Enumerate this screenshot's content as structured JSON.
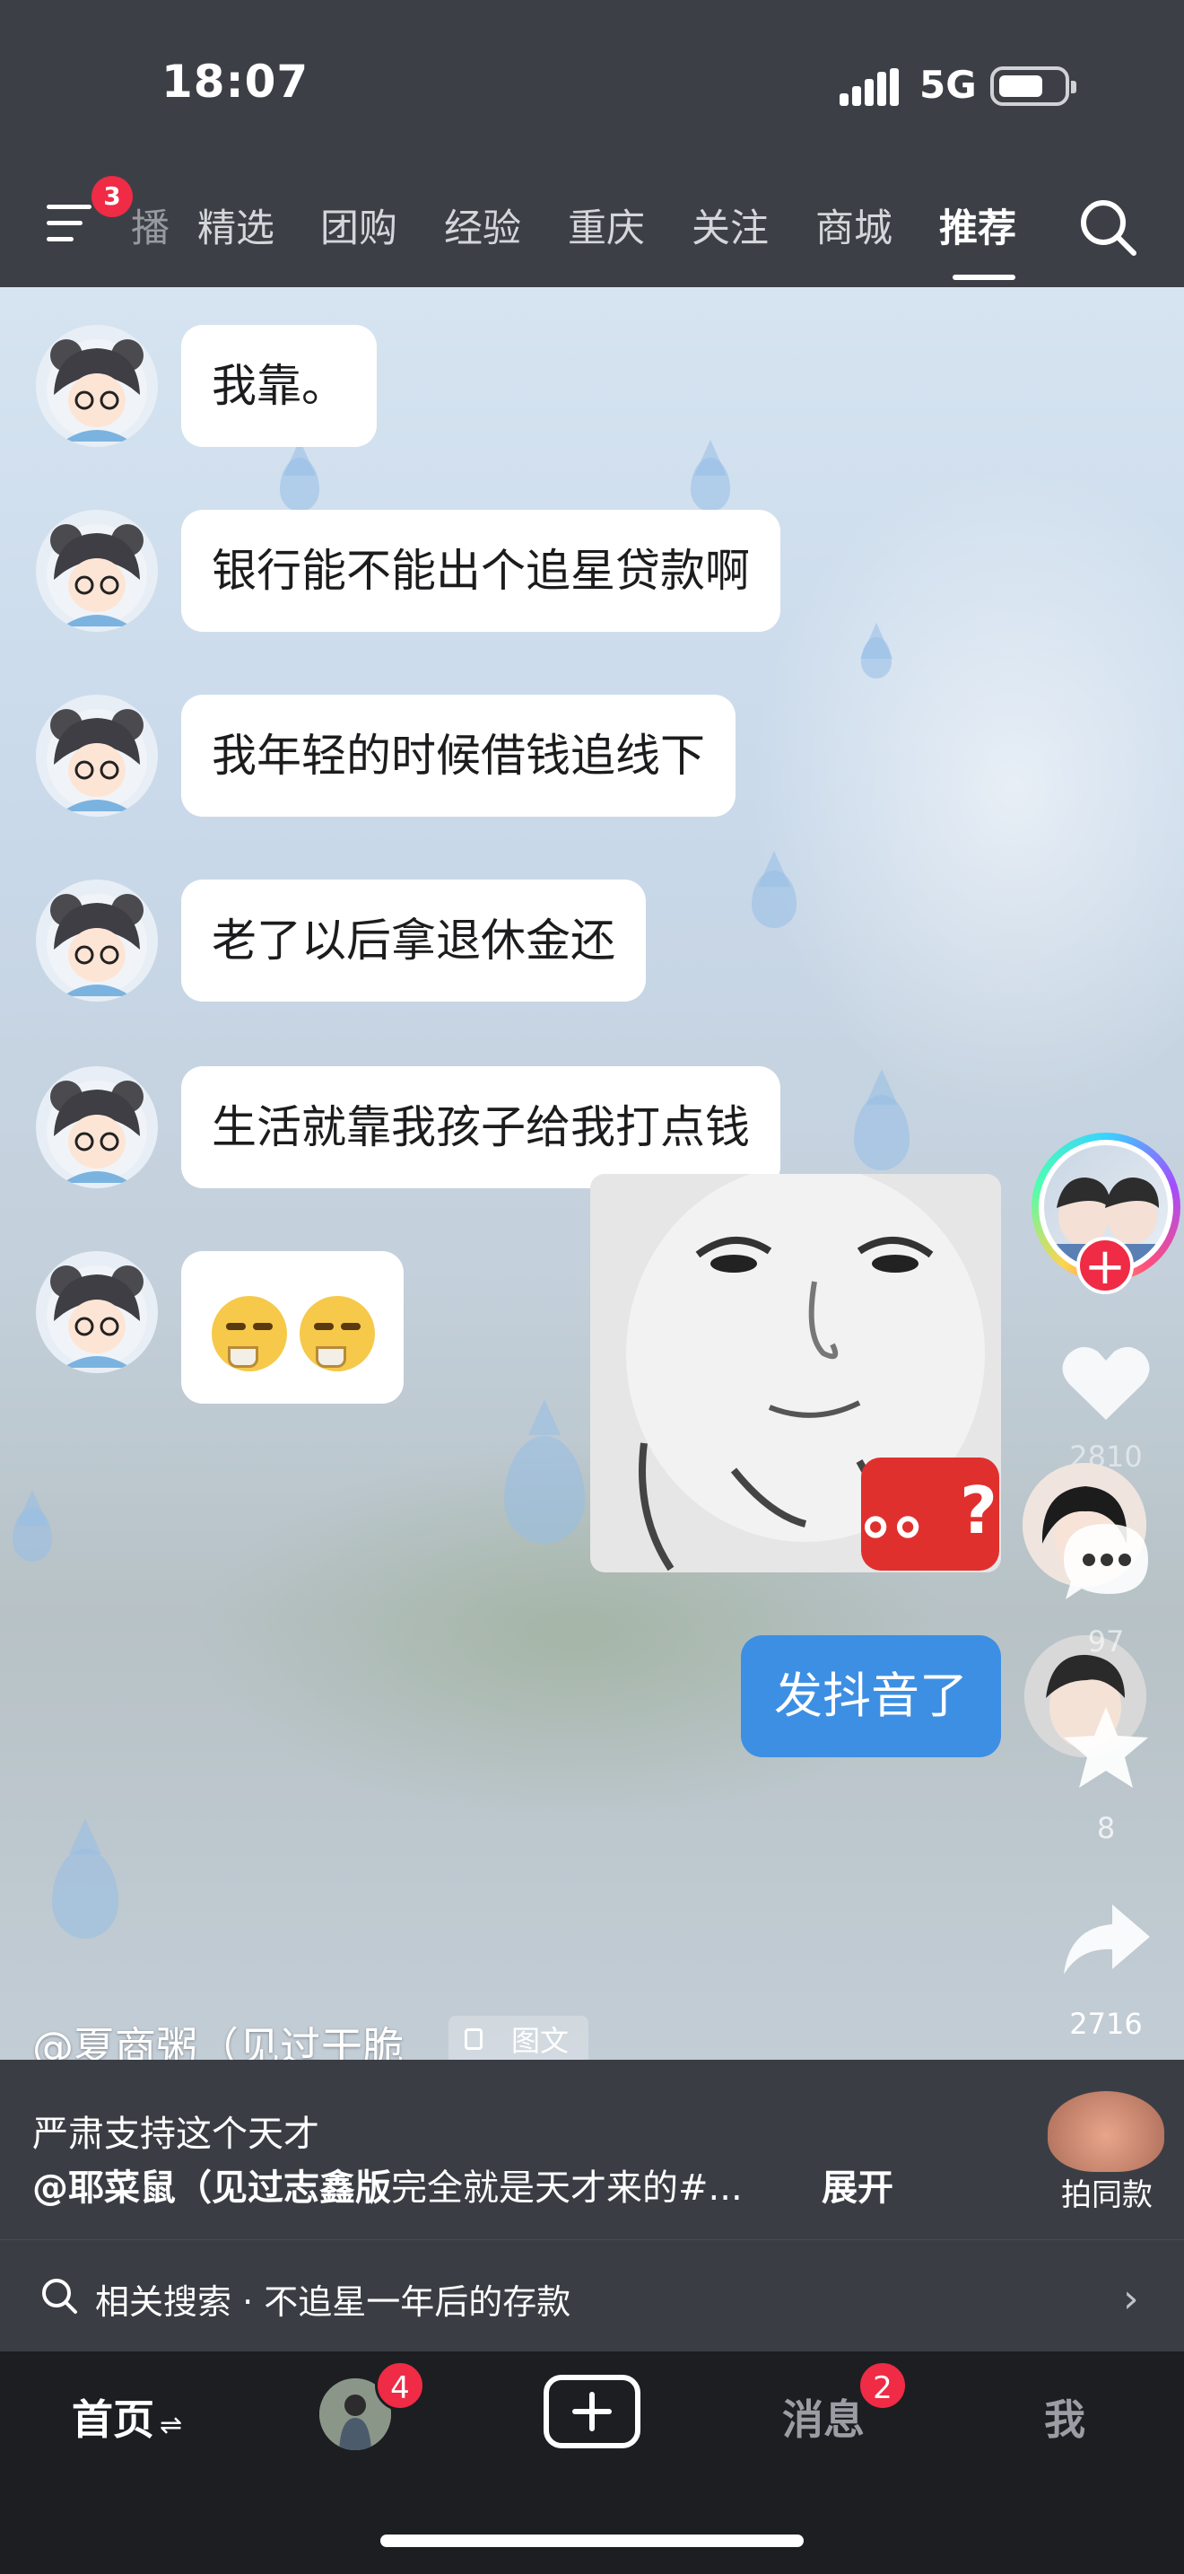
{
  "status_bar": {
    "time": "18:07",
    "network": "5G"
  },
  "top_nav": {
    "menu_badge": "3",
    "tabs": [
      {
        "label": "播"
      },
      {
        "label": "精选"
      },
      {
        "label": "团购"
      },
      {
        "label": "经验"
      },
      {
        "label": "重庆"
      },
      {
        "label": "关注"
      },
      {
        "label": "商城"
      },
      {
        "label": "推荐",
        "active": true
      }
    ]
  },
  "chat": {
    "messages": [
      {
        "text": "我靠。"
      },
      {
        "text": "银行能不能出个追星贷款啊"
      },
      {
        "text": "我年轻的时候借钱追线下"
      },
      {
        "text": "老了以后拿退休金还"
      },
      {
        "text": "生活就靠我孩子给我打点钱"
      }
    ],
    "sticker_badge": "。。?",
    "reply": "发抖音了"
  },
  "actions": {
    "likes": "2810",
    "comments": "97",
    "favorites": "8",
    "shares": "2716"
  },
  "post": {
    "author": "@夏商粥（见过干脆",
    "type_chip": "图文",
    "caption_line1": "严肃支持这个天才",
    "caption_mention": "@耶菜鼠（见过志鑫版",
    "caption_rest": "完全就是天才来的#...",
    "expand": "展开",
    "same_style": "拍同款",
    "related_search": "相关搜索 · 不追星一年后的存款"
  },
  "bottom_nav": {
    "home": "首页",
    "friends_badge": "4",
    "messages": "消息",
    "messages_badge": "2",
    "me": "我"
  },
  "colors": {
    "accent_red": "#ef2b45",
    "reply_blue": "#3d8fe3",
    "nav_bg": "#1c1e22"
  }
}
